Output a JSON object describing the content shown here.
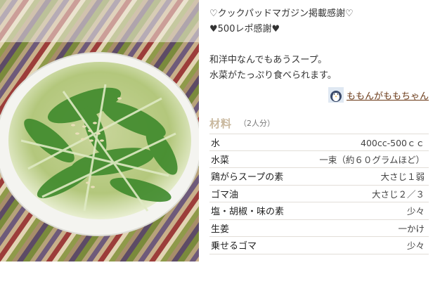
{
  "photo": {
    "alt_icon": "soup-photo"
  },
  "intro": {
    "line1": "♡クックパッドマガジン掲載感謝♡",
    "line2": "♥500レポ感謝♥",
    "line3": "和洋中なんでもあうスープ。",
    "line4": "水菜がたっぷり食べられます。"
  },
  "author": {
    "name": "ももんがももちゃん",
    "avatar_icon": "penguin-avatar-icon"
  },
  "ingredients": {
    "title": "材料",
    "servings": "（2人分）",
    "items": [
      {
        "name": "水",
        "qty": "400cc-500ｃｃ"
      },
      {
        "name": "水菜",
        "qty": "一束（約６０グラムほど）"
      },
      {
        "name": "鶏がらスープの素",
        "qty": "大さじ１弱"
      },
      {
        "name": "ゴマ油",
        "qty": "大さじ２／３"
      },
      {
        "name": "塩・胡椒・味の素",
        "qty": "少々"
      },
      {
        "name": "生姜",
        "qty": "一かけ"
      },
      {
        "name": "乗せるゴマ",
        "qty": "少々"
      }
    ]
  },
  "colors": {
    "title": "#c9b89e",
    "author": "#6b3a18",
    "border": "#e2ded8"
  }
}
